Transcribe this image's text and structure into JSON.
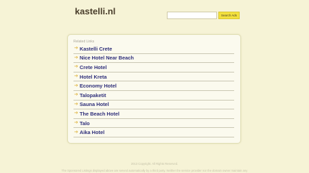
{
  "header": {
    "site_title": "kastelli.nl"
  },
  "search": {
    "placeholder": "",
    "value": "",
    "button_label": "Search Ads"
  },
  "panel": {
    "heading": "Related Links",
    "arrow_glyph": "➔",
    "links": [
      {
        "label": "Kastelli Crete"
      },
      {
        "label": "Nice Hotel Near Beach"
      },
      {
        "label": "Crete Hotel"
      },
      {
        "label": "Hotel Kreta"
      },
      {
        "label": "Economy Hotel"
      },
      {
        "label": "Talopaketit"
      },
      {
        "label": "Sauna Hotel"
      },
      {
        "label": "The Beach Hotel"
      },
      {
        "label": "Talo"
      },
      {
        "label": "Aika Hotel"
      }
    ]
  },
  "footer": {
    "copyright": "2013 Copyright. All Rights Reserved.",
    "disclaimer": "The Sponsored Listings displayed above are served automatically by a third party. Neither the service provider nor the domain owner maintain any"
  },
  "colors": {
    "background": "#f6f3d6",
    "panel_background": "#fbfaee",
    "link_text": "#2f2f7a",
    "arrow": "#e0b94d",
    "search_button": "#f3e13e",
    "title_text": "#4a3e2c"
  }
}
